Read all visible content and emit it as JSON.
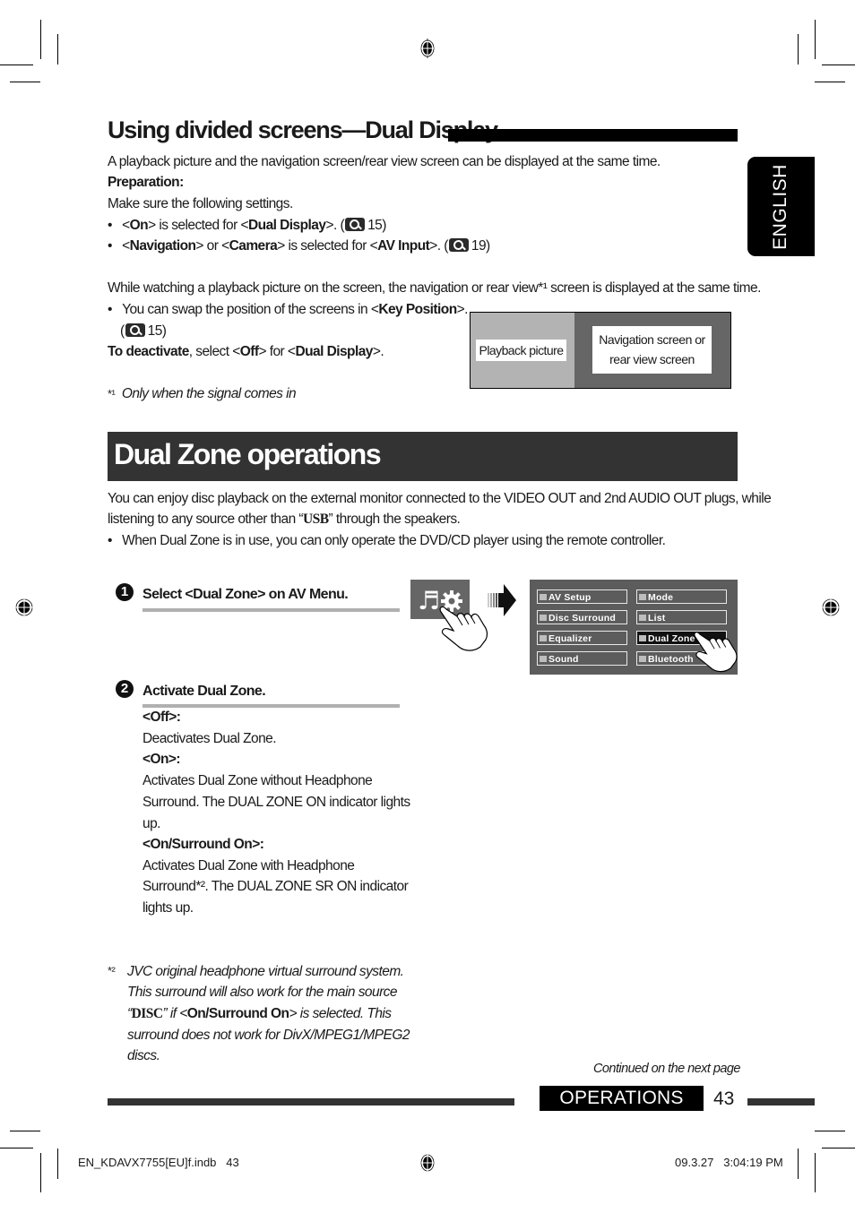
{
  "section1": {
    "title": "Using divided screens—Dual Display",
    "intro": "A playback picture and the navigation screen/rear view screen can be displayed at the same time.",
    "preparation_label": "Preparation:",
    "preparation_text": "Make sure the following settings.",
    "bullets": [
      {
        "pre": "<",
        "b1": "On",
        "mid1": "> is selected for <",
        "b2": "Dual Display",
        "post": ">. (",
        "icon": "reference-magnifier-icon",
        "page": "15)"
      },
      {
        "pre": "<",
        "b1": "Navigation",
        "mid1": "> or <",
        "b2": "Camera",
        "mid2": "> is selected for <",
        "b3": "AV Input",
        "post": ">. (",
        "icon": "reference-magnifier-icon",
        "page": "19)"
      }
    ],
    "watching_text": "While watching a playback picture on the screen, the navigation or rear view*¹ screen is displayed at the same time.",
    "swap_bullet": {
      "pre": "You can swap the position of the screens in <",
      "b": "Key Position",
      "post": ">.",
      "ref_open": "(",
      "page": "15)"
    },
    "deactivate": {
      "b1": "To deactivate",
      "mid": ", select <",
      "b2": "Off",
      "mid2": "> for <",
      "b3": "Dual Display",
      "post": ">."
    },
    "footnote_mark": "*¹",
    "footnote_text": "Only when the signal comes in",
    "diagram": {
      "left_label": "Playback picture",
      "right_label_line1": "Navigation screen or",
      "right_label_line2": "rear view screen"
    }
  },
  "language_tab": "ENGLISH",
  "section2": {
    "title": "Dual Zone operations",
    "intro_line1": "You can enjoy disc playback on the external monitor connected to the VIDEO OUT and 2nd AUDIO OUT plugs, while",
    "intro_line2_pre": "listening to any source other than “",
    "intro_line2_b": "USB",
    "intro_line2_post": "” through the speakers.",
    "bullet": "When Dual Zone is in use, you can only operate the DVD/CD player using the remote controller.",
    "steps": [
      {
        "num": "1",
        "title": "Select <Dual Zone> on AV Menu."
      },
      {
        "num": "2",
        "title": "Activate Dual Zone."
      }
    ],
    "options": [
      {
        "label": "<Off>:",
        "desc": [
          "Deactivates Dual Zone."
        ]
      },
      {
        "label": "<On>:",
        "desc": [
          "Activates Dual Zone without Headphone",
          "Surround. The DUAL ZONE ON indicator lights",
          "up."
        ]
      },
      {
        "label": "<On/Surround On>:",
        "desc": [
          "Activates Dual Zone with Headphone",
          "Surround*². The DUAL ZONE SR ON indicator",
          "lights up."
        ]
      }
    ],
    "footnote_mark": "*²",
    "footnote_lines": [
      "JVC original headphone virtual surround system.",
      "This surround will also work for the main source"
    ],
    "footnote_line3": {
      "q1": "“",
      "b1": "DISC",
      "mid": "” if <",
      "b2": "On/Surround On",
      "post": "> is selected. This"
    },
    "footnote_lines_end": [
      "surround does not work for DivX/MPEG1/MPEG2",
      "discs."
    ],
    "av_menu": {
      "left": [
        "AV Setup",
        "Disc Surround",
        "Equalizer",
        "Sound"
      ],
      "right": [
        "Mode",
        "List",
        "Dual Zone",
        "Bluetooth"
      ],
      "selected": "Dual Zone"
    }
  },
  "footer": {
    "continued": "Continued on the next page",
    "section_label": "OPERATIONS",
    "page_number": "43",
    "file_info": "EN_KDAVX7755[EU]f.indb   43",
    "timestamp": "09.3.27   3:04:19 PM"
  }
}
